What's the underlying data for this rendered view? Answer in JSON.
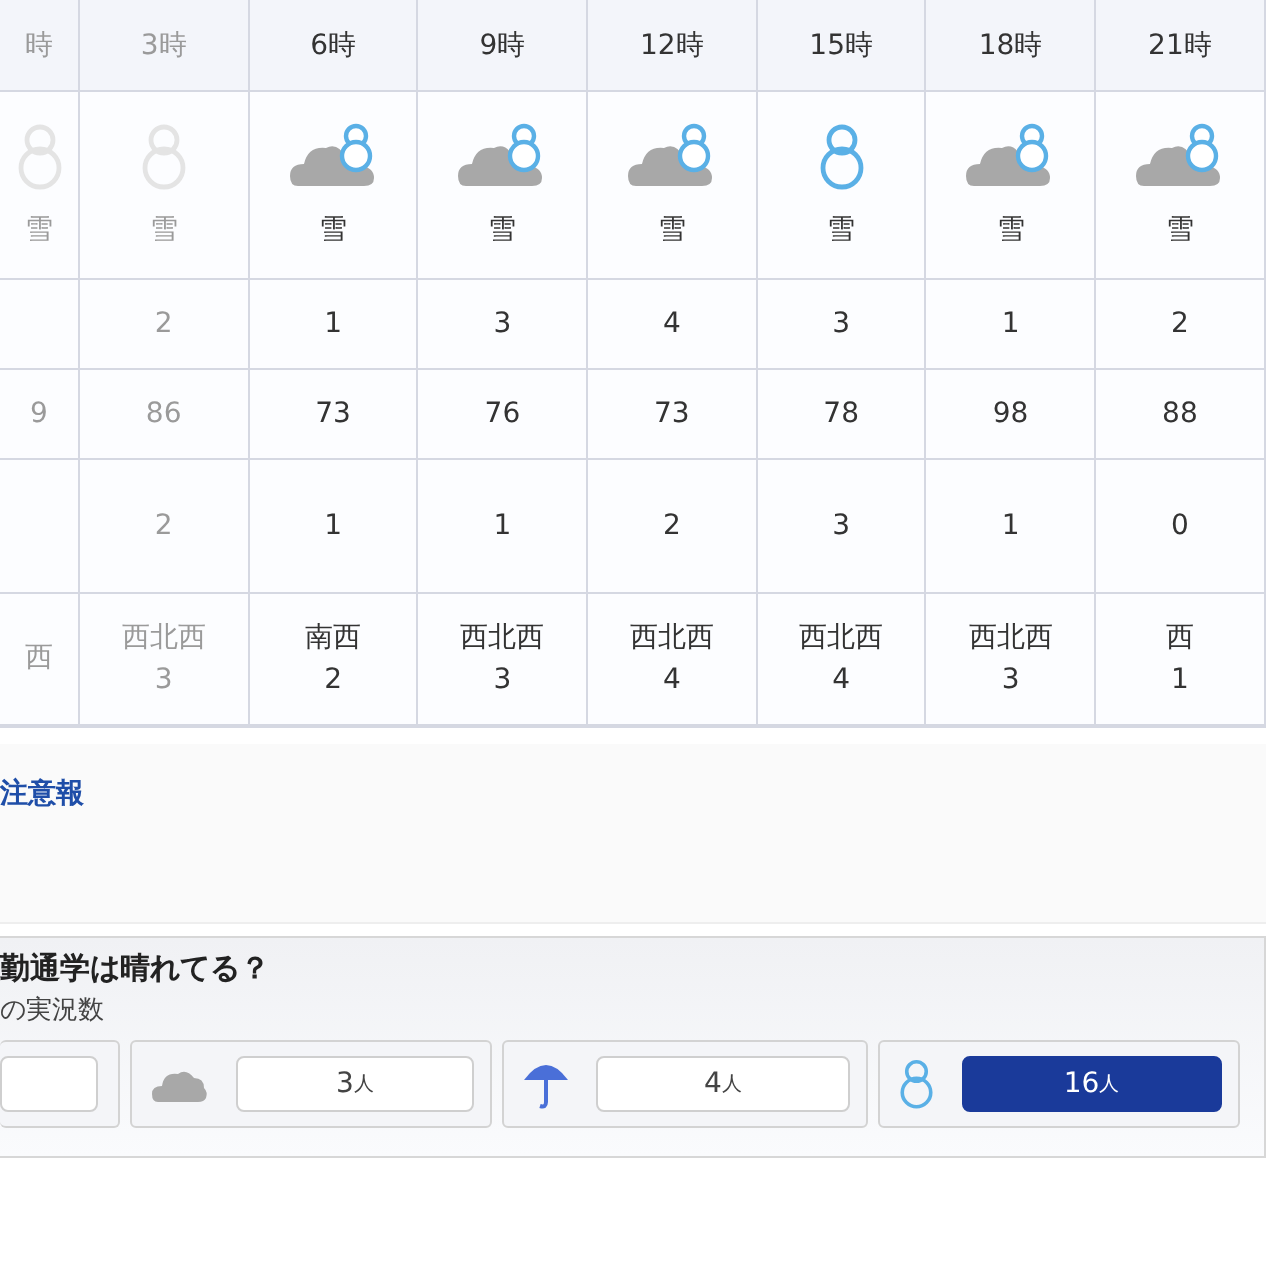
{
  "forecast": {
    "columns": [
      {
        "time": "時",
        "past": true,
        "kind": "snow",
        "weather": "雪",
        "row_4": "9",
        "wind_direction": "西"
      },
      {
        "time": "3時",
        "past": true,
        "kind": "snow",
        "weather": "雪",
        "row_3": "2",
        "row_4": "86",
        "row_5": "2",
        "wind_direction": "西北西",
        "wind_speed": "3"
      },
      {
        "time": "6時",
        "past": false,
        "kind": "cloud-snow",
        "weather": "雪",
        "row_3": "1",
        "row_4": "73",
        "row_5": "1",
        "wind_direction": "南西",
        "wind_speed": "2"
      },
      {
        "time": "9時",
        "past": false,
        "kind": "cloud-snow",
        "weather": "雪",
        "row_3": "3",
        "row_4": "76",
        "row_5": "1",
        "wind_direction": "西北西",
        "wind_speed": "3"
      },
      {
        "time": "12時",
        "past": false,
        "kind": "cloud-snow",
        "weather": "雪",
        "row_3": "4",
        "row_4": "73",
        "row_5": "2",
        "wind_direction": "西北西",
        "wind_speed": "4"
      },
      {
        "time": "15時",
        "past": false,
        "kind": "snow",
        "weather": "雪",
        "row_3": "3",
        "row_4": "78",
        "row_5": "3",
        "wind_direction": "西北西",
        "wind_speed": "4"
      },
      {
        "time": "18時",
        "past": false,
        "kind": "cloud-snow",
        "weather": "雪",
        "row_3": "1",
        "row_4": "98",
        "row_5": "1",
        "wind_direction": "西北西",
        "wind_speed": "3"
      },
      {
        "time": "21時",
        "past": false,
        "kind": "cloud-snow",
        "weather": "雪",
        "row_3": "2",
        "row_4": "88",
        "row_5": "0",
        "wind_direction": "西",
        "wind_speed": "1"
      }
    ]
  },
  "advisory": {
    "link": "注意報"
  },
  "poll": {
    "title": "勤通学は晴れてる？",
    "subtitle": "の実況数",
    "options": [
      {
        "kind": "cut",
        "selected": false
      },
      {
        "kind": "cloud",
        "count": "3",
        "unit": "人",
        "selected": false
      },
      {
        "kind": "umbrella",
        "count": "4",
        "unit": "人",
        "selected": false
      },
      {
        "kind": "snowman",
        "count": "16",
        "unit": "人",
        "selected": true
      }
    ]
  }
}
